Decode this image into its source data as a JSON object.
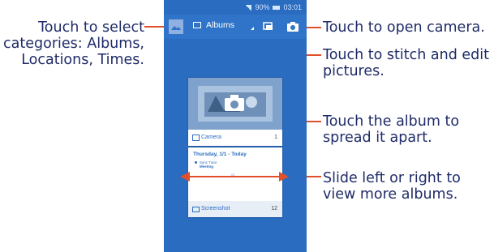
{
  "callouts": {
    "select_categories": [
      "Touch to select",
      "categories: Albums,",
      "Locations, Times."
    ],
    "open_camera": "Touch to open camera.",
    "stitch_edit": [
      "Touch to stitch and edit",
      "pictures."
    ],
    "spread_album": [
      "Touch the album to",
      "spread it apart."
    ],
    "slide_albums": [
      "Slide left or right to",
      "view more albums."
    ]
  },
  "phone": {
    "status": {
      "battery": "90%",
      "time": "03:01"
    },
    "action_bar": {
      "selector_label": "Albums"
    },
    "albums": [
      {
        "name": "Camera",
        "count": "1"
      },
      {
        "name": "Screenshot",
        "count": "12"
      }
    ],
    "screenshot_preview": {
      "date": "Thursday, 1/1 - Today",
      "event_line1": "Sync Tutor",
      "event_line2": "Meeting"
    }
  },
  "colors": {
    "callout_text": "#1f2b68",
    "leader_line": "#e2502b",
    "phone_bg": "#2a6cc0",
    "action_bar": "#2f74c8"
  },
  "icons": [
    "gallery-icon",
    "album-folder-icon",
    "stitch-icon",
    "camera-icon",
    "camera-overlay-icon",
    "folder-icon",
    "chevron-down-icon"
  ]
}
